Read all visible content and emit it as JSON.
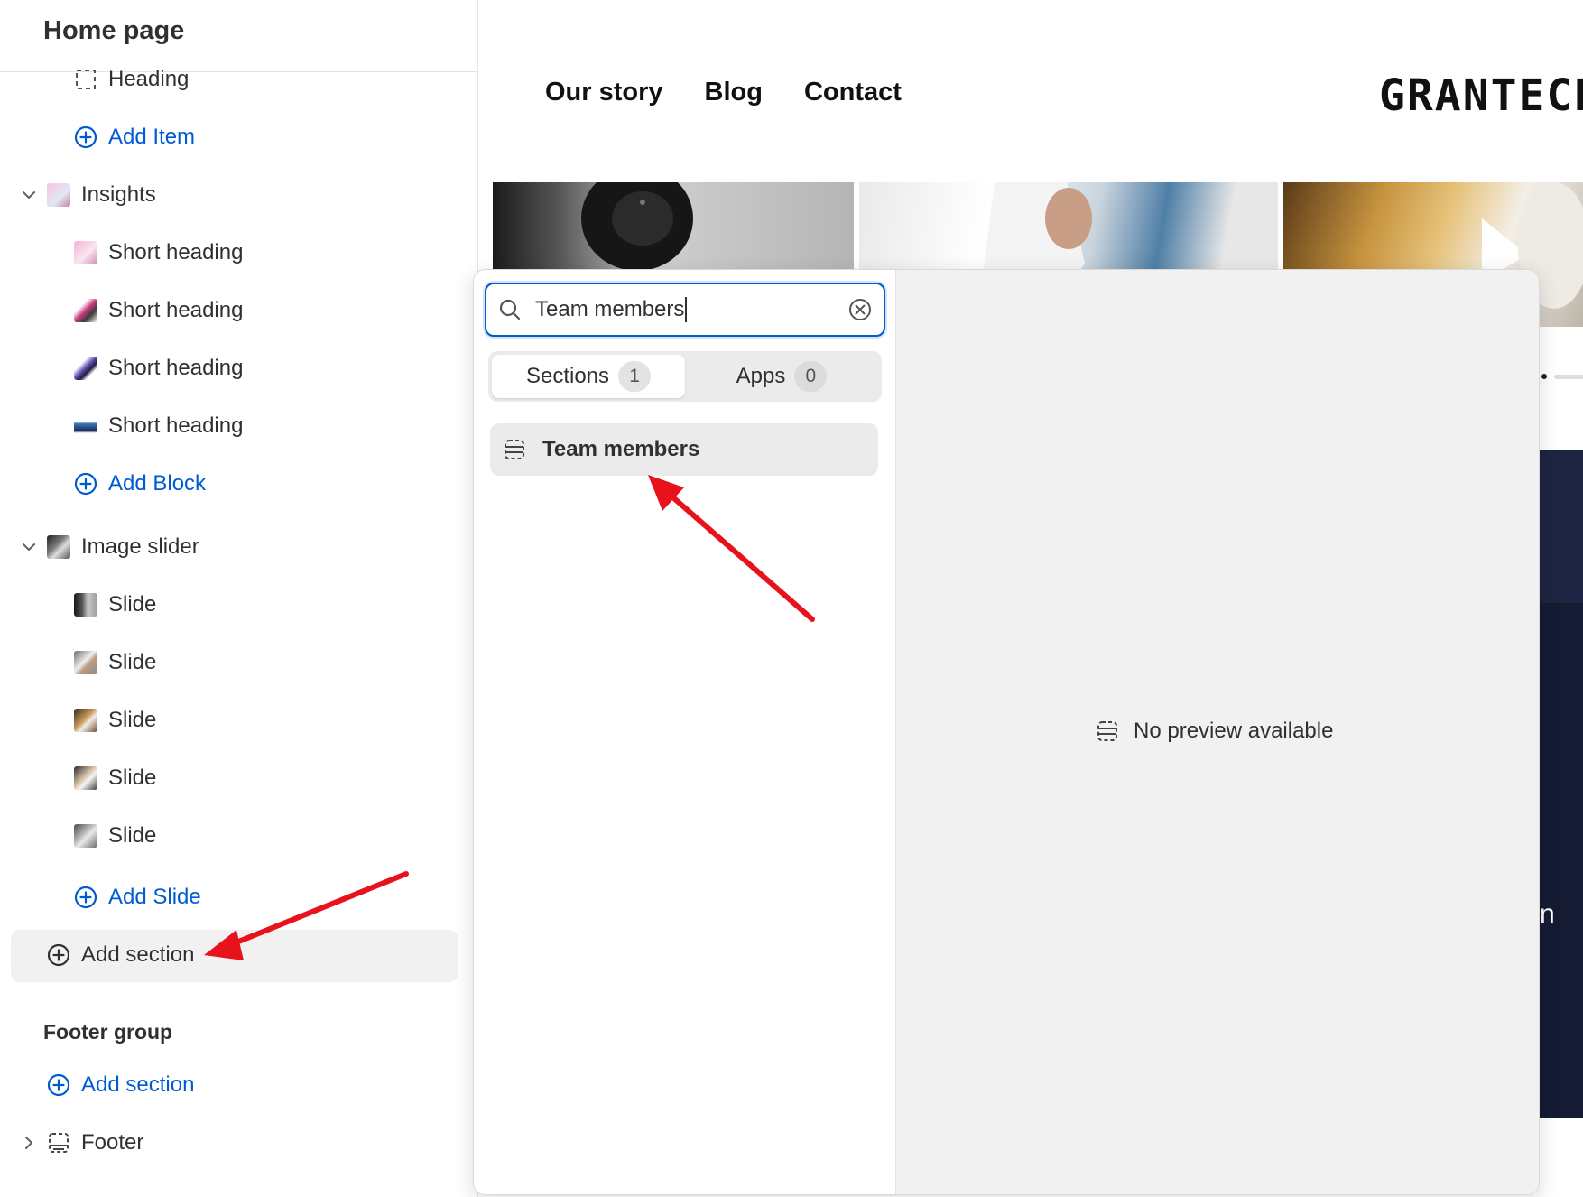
{
  "sidebar": {
    "title": "Home page",
    "items": [
      {
        "label": "Heading"
      },
      {
        "label": "Add Item"
      },
      {
        "label": "Insights"
      },
      {
        "label": "Short heading"
      },
      {
        "label": "Short heading"
      },
      {
        "label": "Short heading"
      },
      {
        "label": "Short heading"
      },
      {
        "label": "Add Block"
      },
      {
        "label": "Image slider"
      },
      {
        "label": "Slide"
      },
      {
        "label": "Slide"
      },
      {
        "label": "Slide"
      },
      {
        "label": "Slide"
      },
      {
        "label": "Slide"
      },
      {
        "label": "Add Slide"
      },
      {
        "label": "Add section"
      }
    ],
    "footer_group": {
      "title": "Footer group",
      "add_section": "Add section",
      "footer": "Footer"
    }
  },
  "storefront": {
    "nav": [
      "Our story",
      "Blog",
      "Contact"
    ],
    "brand": "GRANTECH",
    "edge_letter": "n"
  },
  "picker": {
    "search_value": "Team members",
    "tabs": [
      {
        "label": "Sections",
        "count": "1"
      },
      {
        "label": "Apps",
        "count": "0"
      }
    ],
    "result": "Team members",
    "no_preview": "No preview available"
  },
  "colors": {
    "accent": "#005bd3",
    "arrow": "#e8121c"
  },
  "icons": {
    "search": "magnifier-icon",
    "clear": "circle-x-icon",
    "section": "section-layout-icon",
    "add": "circle-plus-icon"
  }
}
